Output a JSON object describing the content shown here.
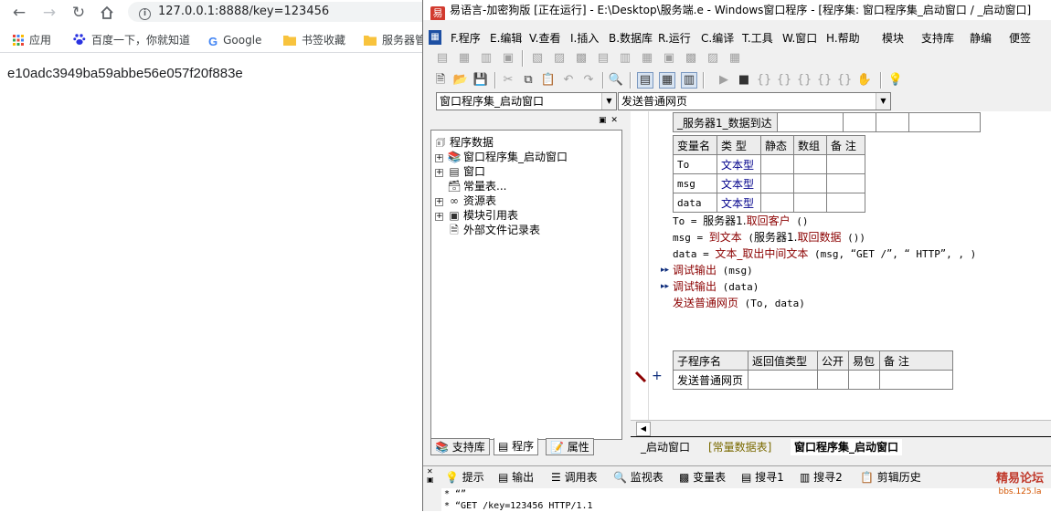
{
  "browser": {
    "url": "127.0.0.1:8888/key=123456",
    "bookmarks": [
      {
        "label": "应用",
        "icon": "apps-grid-icon"
      },
      {
        "label": "百度一下，你就知道",
        "icon": "baidu-paw-icon"
      },
      {
        "label": "Google",
        "icon": "google-g-icon"
      },
      {
        "label": "书签收藏",
        "icon": "folder-icon"
      },
      {
        "label": "服务器管",
        "icon": "folder-icon"
      }
    ],
    "page_text": "e10adc3949ba59abbe56e057f20f883e"
  },
  "ide": {
    "title": "易语言-加密狗版 [正在运行] - E:\\Desktop\\服务端.e - Windows窗口程序 - [程序集: 窗口程序集_启动窗口 / _启动窗口]",
    "menus": [
      "F.程序",
      "E.编辑",
      "V.查看",
      "I.插入",
      "B.数据库",
      "R.运行",
      "C.编译",
      "T.工具",
      "W.窗口",
      "H.帮助",
      "模块",
      "支持库",
      "静编",
      "便签"
    ],
    "combo_left": "窗口程序集_启动窗口",
    "combo_right": "发送普通网页",
    "tree": {
      "root": "程序数据",
      "items": [
        {
          "label": "窗口程序集_启动窗口",
          "expand": "+",
          "icon": "program-set-icon"
        },
        {
          "label": "窗口",
          "expand": "+",
          "icon": "window-icon"
        },
        {
          "label": "常量表...",
          "expand": "",
          "icon": "constants-icon"
        },
        {
          "label": "资源表",
          "expand": "+",
          "icon": "resource-icon"
        },
        {
          "label": "模块引用表",
          "expand": "+",
          "icon": "module-ref-icon"
        },
        {
          "label": "外部文件记录表",
          "expand": "",
          "icon": "file-record-icon"
        }
      ]
    },
    "panel_tabs": [
      {
        "label": "支持库",
        "icon": "library-icon"
      },
      {
        "label": "程序",
        "icon": "program-icon"
      },
      {
        "label": "属性",
        "icon": "properties-icon"
      }
    ],
    "event_name": "_服务器1_数据到达",
    "var_table": {
      "headers": [
        "变量名",
        "类 型",
        "静态",
        "数组",
        "备 注"
      ],
      "rows": [
        {
          "name": "To",
          "type": "文本型"
        },
        {
          "name": "msg",
          "type": "文本型"
        },
        {
          "name": "data",
          "type": "文本型"
        }
      ]
    },
    "code_lines": [
      {
        "parts": [
          {
            "t": "To = ",
            "c": ""
          },
          {
            "t": "服务器1.",
            "c": "cn"
          },
          {
            "t": "取回客户",
            "c": "kw cn"
          },
          {
            "t": " ()",
            "c": ""
          }
        ],
        "arrow": false
      },
      {
        "parts": [
          {
            "t": "msg = ",
            "c": ""
          },
          {
            "t": "到文本",
            "c": "kw cn"
          },
          {
            "t": " (",
            "c": ""
          },
          {
            "t": "服务器1.",
            "c": "cn"
          },
          {
            "t": "取回数据",
            "c": "kw cn"
          },
          {
            "t": " ())",
            "c": ""
          }
        ],
        "arrow": false
      },
      {
        "parts": [
          {
            "t": "data = ",
            "c": ""
          },
          {
            "t": "文本_取出中间文本",
            "c": "kw cn"
          },
          {
            "t": " (msg, ",
            "c": ""
          },
          {
            "t": "“",
            "c": "cn"
          },
          {
            "t": "GET /",
            "c": ""
          },
          {
            "t": "”",
            "c": "cn"
          },
          {
            "t": ", ",
            "c": ""
          },
          {
            "t": "“",
            "c": "cn"
          },
          {
            "t": " HTTP",
            "c": ""
          },
          {
            "t": "”",
            "c": "cn"
          },
          {
            "t": ", , )",
            "c": ""
          }
        ],
        "arrow": false
      },
      {
        "parts": [
          {
            "t": "调试输出",
            "c": "kw cn"
          },
          {
            "t": " (msg)",
            "c": ""
          }
        ],
        "arrow": true
      },
      {
        "parts": [
          {
            "t": "调试输出",
            "c": "kw cn"
          },
          {
            "t": " (data)",
            "c": ""
          }
        ],
        "arrow": true
      },
      {
        "parts": [
          {
            "t": "发送普通网页",
            "c": "kw cn"
          },
          {
            "t": " (To, data)",
            "c": ""
          }
        ],
        "arrow": false
      }
    ],
    "sub_table": {
      "headers": [
        "子程序名",
        "返回值类型",
        "公开",
        "易包",
        "备 注"
      ],
      "row_name": "发送普通网页"
    },
    "code_tabs": [
      "_启动窗口",
      "[常量数据表]",
      "窗口程序集_启动窗口"
    ],
    "output_tabs": [
      {
        "label": "提示",
        "icon": "lightbulb-icon"
      },
      {
        "label": "输出",
        "icon": "output-icon"
      },
      {
        "label": "调用表",
        "icon": "call-table-icon"
      },
      {
        "label": "监视表",
        "icon": "magnifier-icon"
      },
      {
        "label": "变量表",
        "icon": "variable-icon"
      },
      {
        "label": "搜寻1",
        "icon": "search1-icon"
      },
      {
        "label": "搜寻2",
        "icon": "search2-icon"
      },
      {
        "label": "剪辑历史",
        "icon": "clipboard-history-icon"
      }
    ],
    "output_lines": [
      "* “”",
      "* “GET /key=123456 HTTP/1.1"
    ],
    "watermark": {
      "title": "精易论坛",
      "sub": "bbs.125.la"
    }
  }
}
